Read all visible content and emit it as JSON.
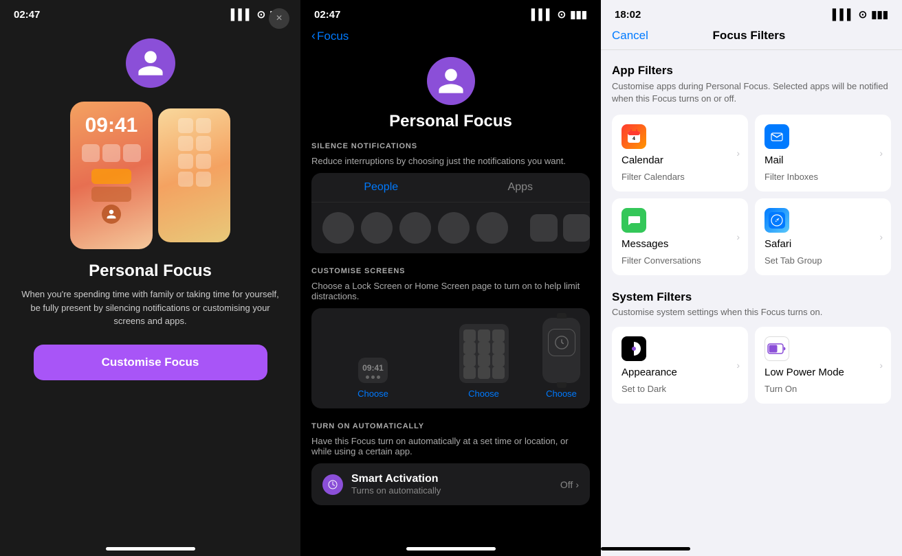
{
  "screen1": {
    "status_time": "02:47",
    "close_label": "×",
    "avatar_label": "person",
    "phone_time": "09:41",
    "title": "Personal Focus",
    "description": "When you're spending time with family or taking time for yourself, be fully present by silencing notifications or customising your screens and apps.",
    "button_label": "Customise Focus"
  },
  "screen2": {
    "status_time": "02:47",
    "back_label": "Focus",
    "title": "Personal Focus",
    "silence_label": "SILENCE NOTIFICATIONS",
    "silence_desc": "Reduce interruptions by choosing just the notifications you want.",
    "tab_people": "People",
    "tab_apps": "Apps",
    "customise_label": "CUSTOMISE SCREENS",
    "customise_desc": "Choose a Lock Screen or Home Screen page to turn on to help limit distractions.",
    "choose1": "Choose",
    "choose2": "Choose",
    "choose3": "Choose",
    "mini_time": "09:41",
    "auto_label": "TURN ON AUTOMATICALLY",
    "auto_desc": "Have this Focus turn on automatically at a set time or location, or while using a certain app.",
    "smart_activation": "Smart Activation",
    "smart_sub": "Turns on automatically",
    "smart_value": "Off"
  },
  "screen3": {
    "status_time": "18:02",
    "cancel_label": "Cancel",
    "title": "Focus Filters",
    "app_filters_title": "App Filters",
    "app_filters_desc": "Customise apps during Personal Focus. Selected apps will be notified when this Focus turns on or off.",
    "calendar_title": "Calendar",
    "calendar_sub": "Filter Calendars",
    "mail_title": "Mail",
    "mail_sub": "Filter Inboxes",
    "messages_title": "Messages",
    "messages_sub": "Filter Conversations",
    "safari_title": "Safari",
    "safari_sub": "Set Tab Group",
    "system_filters_title": "System Filters",
    "system_filters_desc": "Customise system settings when this Focus turns on.",
    "appearance_title": "Appearance",
    "appearance_sub": "Set to Dark",
    "lowpower_title": "Low Power Mode",
    "lowpower_sub": "Turn On"
  }
}
